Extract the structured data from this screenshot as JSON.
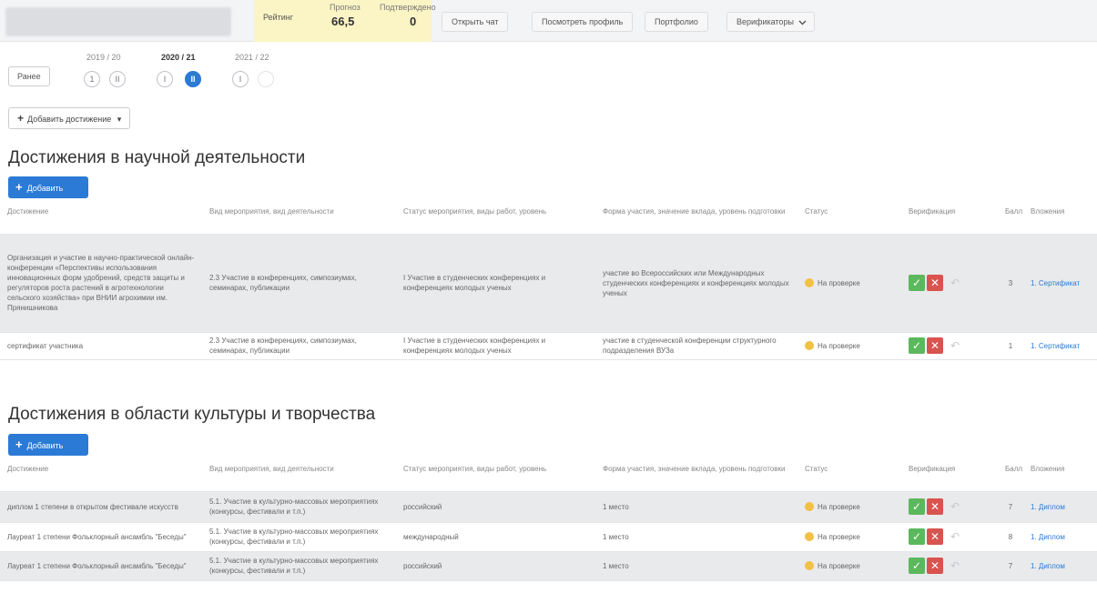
{
  "topbar": {
    "rating_label": "Рейтинг",
    "forecast_label": "Прогноз",
    "confirmed_label": "Подтверждено",
    "forecast_value": "66,5",
    "confirmed_value": "0",
    "buttons": [
      "Открыть чат",
      "Посмотреть профиль",
      "Портфолио",
      "Верификаторы"
    ]
  },
  "periods": {
    "earlier_label": "Ранее",
    "years": [
      {
        "label": "2019 / 20",
        "semesters": [
          "1",
          "II"
        ]
      },
      {
        "label": "2020 / 21",
        "semesters": [
          "I",
          "II"
        ]
      },
      {
        "label": "2021 / 22",
        "semesters": [
          "I"
        ]
      }
    ]
  },
  "add_achievement_label": "Добавить достижение",
  "add_label": "Добавить",
  "columns": [
    "Достижение",
    "Вид мероприятия, вид деятельности",
    "Статус мероприятия, виды работ, уровень",
    "Форма участия, значение вклада, уровень подготовки",
    "Статус",
    "Верификация",
    "Балл",
    "Вложения"
  ],
  "sections": [
    {
      "title": "Достижения в научной деятельности",
      "rows": [
        {
          "achievement": "Организация и участие в научно-практической онлайн-конференции «Перспективы использования инновационных форм удобрений, средств защиты и регуляторов роста растений в агротехнологии сельского хозяйства» при ВНИИ агрохимии им. Прянишникова",
          "type": "2.3 Участие в конференциях, симпозиумах, семинарах, публикации",
          "level": "I Участие в студенческих конференциях и конференциях молодых ученых",
          "form": "участие во Всероссийских или Международных студенческих конференциях и конференциях молодых ученых",
          "status": "На проверке",
          "score": "3",
          "attachment": "1. Сертификат"
        },
        {
          "achievement": "сертификат участника",
          "type": "2.3 Участие в конференциях, симпозиумах, семинарах, публикации",
          "level": "I Участие в студенческих конференциях и конференциях молодых ученых",
          "form": "участие в студенческой конференции структурного подразделения ВУЗа",
          "status": "На проверке",
          "score": "1",
          "attachment": "1. Сертификат"
        }
      ]
    },
    {
      "title": "Достижения в области культуры и творчества",
      "rows": [
        {
          "achievement": "диплом 1 степени в открытом фестивале искусств",
          "type": "5.1. Участие в культурно-массовых мероприятиях (конкурсы, фестивали и т.п.)",
          "level": "российский",
          "form": "1 место",
          "status": "На проверке",
          "score": "7",
          "attachment": "1. Диплом"
        },
        {
          "achievement": "Лауреат 1 степени Фольклорный ансамбль \"Беседы\"",
          "type": "5.1. Участие в культурно-массовых мероприятиях (конкурсы, фестивали и т.п.)",
          "level": "международный",
          "form": "1 место",
          "status": "На проверке",
          "score": "8",
          "attachment": "1. Диплом"
        },
        {
          "achievement": "Лауреат 1 степени Фольклорный ансамбль \"Беседы\"",
          "type": "5.1. Участие в культурно-массовых мероприятиях (конкурсы, фестивали и т.п.)",
          "level": "российский",
          "form": "1 место",
          "status": "На проверке",
          "score": "7",
          "attachment": "1. Диплом"
        }
      ]
    }
  ]
}
